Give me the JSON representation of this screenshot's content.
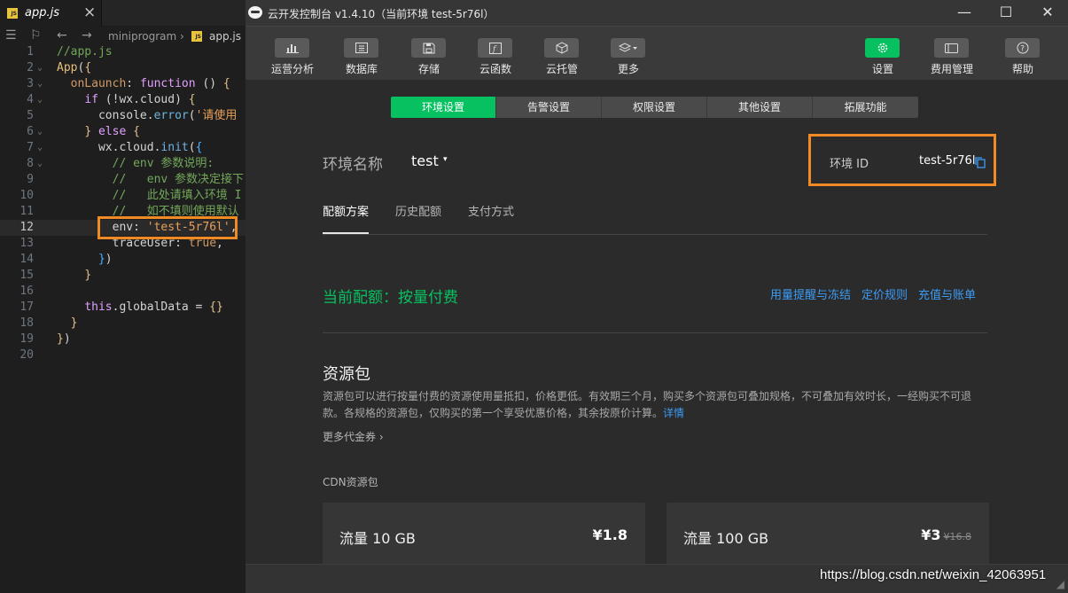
{
  "editor": {
    "tab": {
      "label": "app.js",
      "close_glyph": "×"
    },
    "breadcrumb": {
      "folder": "miniprogram",
      "sep": "›",
      "file": "app.js"
    },
    "lines": [
      {
        "n": "1",
        "tokens": [
          [
            "tk-cmt",
            "//app.js"
          ]
        ]
      },
      {
        "n": "2",
        "tokens": [
          [
            "tk-app",
            "App"
          ],
          [
            "tk-punc",
            "("
          ],
          [
            "tk-brc",
            "{"
          ]
        ]
      },
      {
        "n": "3",
        "tokens": [
          [
            "tk-punc",
            "  "
          ],
          [
            "tk-key",
            "onLaunch"
          ],
          [
            "tk-punc",
            ": "
          ],
          [
            "tk-kw",
            "function"
          ],
          [
            "tk-punc",
            " () "
          ],
          [
            "tk-brc",
            "{"
          ]
        ]
      },
      {
        "n": "4",
        "tokens": [
          [
            "tk-punc",
            "    "
          ],
          [
            "tk-kw",
            "if"
          ],
          [
            "tk-punc",
            " (!"
          ],
          [
            "tk-id",
            "wx"
          ],
          [
            "tk-punc",
            "."
          ],
          [
            "tk-id",
            "cloud"
          ],
          [
            "tk-punc",
            ") "
          ],
          [
            "tk-brc",
            "{"
          ]
        ]
      },
      {
        "n": "5",
        "tokens": [
          [
            "tk-punc",
            "      "
          ],
          [
            "tk-id",
            "console"
          ],
          [
            "tk-punc",
            "."
          ],
          [
            "tk-fn",
            "error"
          ],
          [
            "tk-punc",
            "("
          ],
          [
            "tk-str",
            "'请使用"
          ]
        ]
      },
      {
        "n": "6",
        "tokens": [
          [
            "tk-punc",
            "    "
          ],
          [
            "tk-brc",
            "}"
          ],
          [
            "tk-punc",
            " "
          ],
          [
            "tk-kw",
            "else"
          ],
          [
            "tk-punc",
            " "
          ],
          [
            "tk-brc",
            "{"
          ]
        ]
      },
      {
        "n": "7",
        "tokens": [
          [
            "tk-punc",
            "      "
          ],
          [
            "tk-id",
            "wx"
          ],
          [
            "tk-punc",
            "."
          ],
          [
            "tk-id",
            "cloud"
          ],
          [
            "tk-punc",
            "."
          ],
          [
            "tk-fn",
            "init"
          ],
          [
            "tk-punc",
            "("
          ],
          [
            "tk-blue",
            "{"
          ]
        ]
      },
      {
        "n": "8",
        "tokens": [
          [
            "tk-cmt",
            "        // env 参数说明:"
          ]
        ]
      },
      {
        "n": "9",
        "tokens": [
          [
            "tk-cmt",
            "        //   env 参数决定接下"
          ]
        ]
      },
      {
        "n": "10",
        "tokens": [
          [
            "tk-cmt",
            "        //   此处请填入环境 I"
          ]
        ]
      },
      {
        "n": "11",
        "tokens": [
          [
            "tk-cmt",
            "        //   如不填则使用默认"
          ]
        ]
      },
      {
        "n": "12",
        "tokens": [
          [
            "tk-punc",
            "        "
          ],
          [
            "tk-id",
            "env"
          ],
          [
            "tk-punc",
            ": "
          ],
          [
            "tk-str",
            "'test-5r76l'"
          ],
          [
            "tk-punc",
            ","
          ]
        ]
      },
      {
        "n": "13",
        "tokens": [
          [
            "tk-punc",
            "        "
          ],
          [
            "tk-id",
            "traceUser"
          ],
          [
            "tk-punc",
            ": "
          ],
          [
            "tk-bool",
            "true"
          ],
          [
            "tk-punc",
            ","
          ]
        ]
      },
      {
        "n": "14",
        "tokens": [
          [
            "tk-punc",
            "      "
          ],
          [
            "tk-blue",
            "}"
          ],
          [
            "tk-punc",
            ")"
          ]
        ]
      },
      {
        "n": "15",
        "tokens": [
          [
            "tk-punc",
            "    "
          ],
          [
            "tk-brc",
            "}"
          ]
        ]
      },
      {
        "n": "16",
        "tokens": []
      },
      {
        "n": "17",
        "tokens": [
          [
            "tk-punc",
            "    "
          ],
          [
            "tk-kw",
            "this"
          ],
          [
            "tk-punc",
            "."
          ],
          [
            "tk-id",
            "globalData"
          ],
          [
            "tk-punc",
            " = "
          ],
          [
            "tk-brc",
            "{}"
          ]
        ]
      },
      {
        "n": "18",
        "tokens": [
          [
            "tk-punc",
            "  "
          ],
          [
            "tk-brc",
            "}"
          ]
        ]
      },
      {
        "n": "19",
        "tokens": [
          [
            "tk-brc",
            "}"
          ],
          [
            "tk-punc",
            ")"
          ]
        ]
      },
      {
        "n": "20",
        "tokens": []
      }
    ],
    "current_line": "12",
    "fold_lines": [
      "2",
      "3",
      "4",
      "6",
      "7",
      "8"
    ]
  },
  "console": {
    "title": "云开发控制台 v1.4.10（当前环境 test-5r76l）",
    "window_buttons": {
      "minimize": "—",
      "maximize": "☐",
      "close": "✕"
    },
    "toolbar_left": [
      {
        "label": "运营分析",
        "icon": "bar-chart-icon"
      },
      {
        "label": "数据库",
        "icon": "database-icon"
      },
      {
        "label": "存储",
        "icon": "storage-icon"
      },
      {
        "label": "云函数",
        "icon": "cloud-function-icon"
      },
      {
        "label": "云托管",
        "icon": "cube-icon"
      },
      {
        "label": "更多",
        "icon": "layers-icon"
      }
    ],
    "toolbar_right": [
      {
        "label": "设置",
        "icon": "gear-icon",
        "active": true
      },
      {
        "label": "费用管理",
        "icon": "billing-icon"
      },
      {
        "label": "帮助",
        "icon": "help-icon"
      }
    ],
    "segment_tabs": [
      "环境设置",
      "告警设置",
      "权限设置",
      "其他设置",
      "拓展功能"
    ],
    "env": {
      "label": "环境名称",
      "value": "test",
      "caret": "▾",
      "id_label": "环境 ID",
      "id_value": "test-5r76l"
    },
    "subtabs": [
      "配额方案",
      "历史配额",
      "支付方式"
    ],
    "quota": {
      "label": "当前配额：按量付费",
      "links": [
        "用量提醒与冻结",
        "定价规则",
        "充值与账单"
      ]
    },
    "resource": {
      "title": "资源包",
      "desc": "资源包可以进行按量付费的资源使用量抵扣，价格更低。有效期三个月，购买多个资源包可叠加规格，不可叠加有效时长，一经购买不可退款。各规格的资源包，仅购买的第一个享受优惠价格，其余按原价计算。",
      "desc_link": "详情",
      "more_coupons": "更多代金券 ›",
      "cdn_title": "CDN资源包",
      "cards": [
        {
          "name": "流量 10 GB",
          "price": "¥1.8",
          "old_price": ""
        },
        {
          "name": "流量 100 GB",
          "price": "¥3",
          "old_price": "¥16.8"
        }
      ]
    },
    "statusbar": {
      "grip": "◢"
    }
  },
  "watermark": "https://blog.csdn.net/weixin_42063951",
  "colors": {
    "accent_green": "#07c160",
    "highlight_orange": "#f08a24",
    "link_blue": "#3d9cf5"
  }
}
